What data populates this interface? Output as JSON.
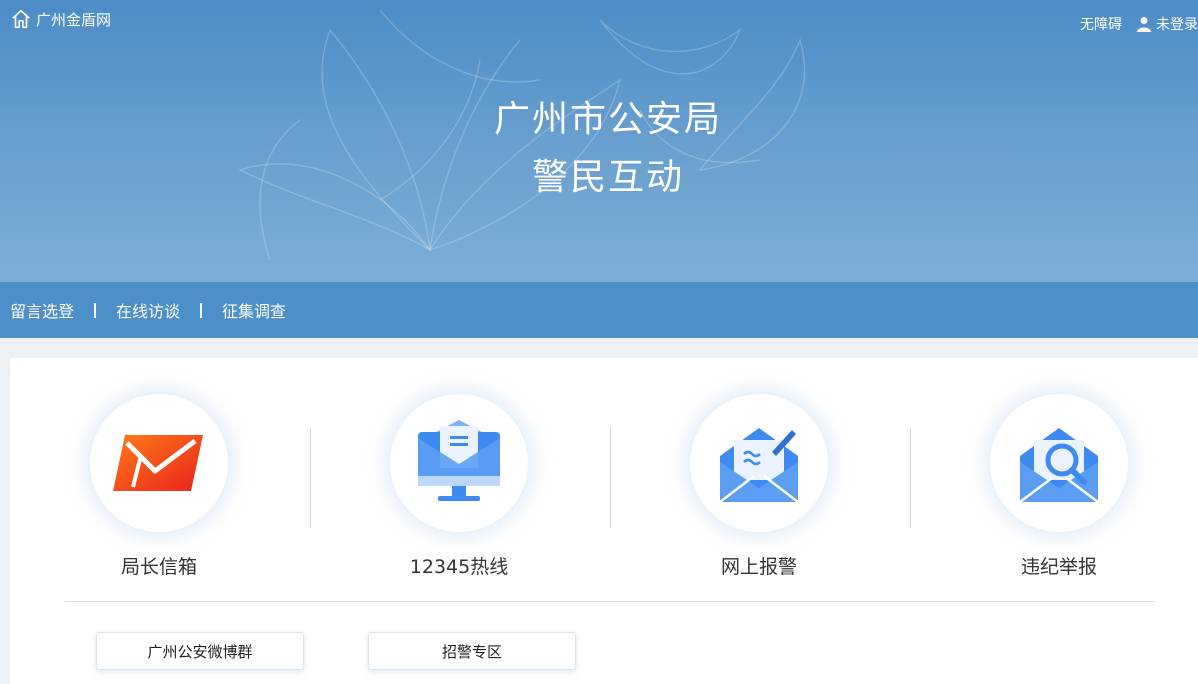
{
  "header": {
    "site_name": "广州金盾网",
    "accessibility": "无障碍",
    "login_status": "未登录",
    "title_line1": "广州市公安局",
    "title_line2": "警民互动"
  },
  "nav": {
    "items": [
      {
        "label": "留言选登"
      },
      {
        "label": "在线访谈"
      },
      {
        "label": "征集调查"
      }
    ]
  },
  "services": [
    {
      "label": "局长信箱",
      "icon": "mail-icon"
    },
    {
      "label": "12345热线",
      "icon": "hotline-monitor-icon"
    },
    {
      "label": "网上报警",
      "icon": "online-report-icon"
    },
    {
      "label": "违纪举报",
      "icon": "discipline-report-icon"
    }
  ],
  "links": [
    {
      "label": "广州公安微博群"
    },
    {
      "label": "招警专区"
    }
  ],
  "colors": {
    "banner": "#4c8dc7",
    "nav_bar": "#4d90c9",
    "icon_blue": "#3d8af0",
    "mail_orange": "#f04a1a"
  }
}
